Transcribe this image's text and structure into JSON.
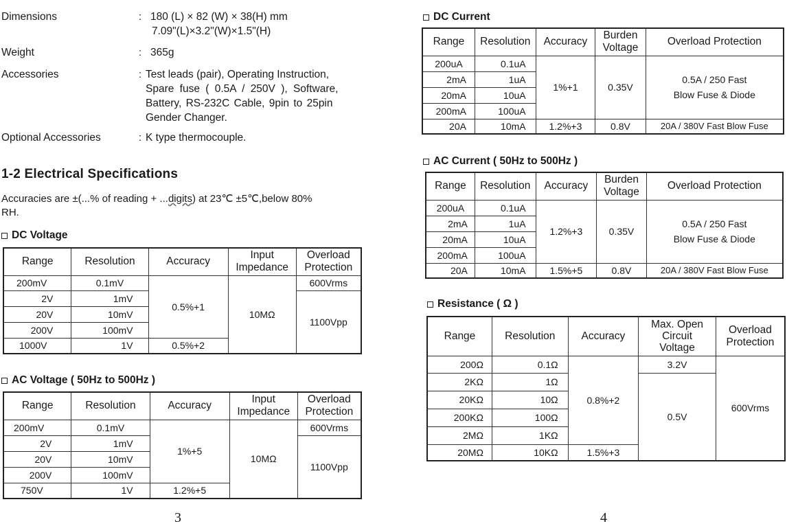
{
  "left_page": {
    "general_specs": [
      {
        "label": "Dimensions",
        "value_lines": [
          "180 (L) × 82 (W) × 38(H) mm",
          "7.09\"(L)×3.2\"(W)×1.5\"(H)"
        ]
      },
      {
        "label": "Weight",
        "value_lines": [
          "365g"
        ]
      },
      {
        "label": "Accessories",
        "value_lines": [
          "Test leads (pair), Operating Instruction,",
          "Spare fuse ( 0.5A / 250V ), Software,",
          "Battery, RS-232C Cable, 9pin to 25pin",
          "Gender Changer."
        ]
      },
      {
        "label": "Optional Accessories",
        "value_lines": [
          "K type thermocouple."
        ]
      }
    ],
    "colon": ":",
    "section_title": "1-2  Electrical Specifications",
    "accuracy_note": {
      "before": "Accuracies are ±(...% of reading + ...",
      "underlined": "digits",
      "after": ") at 23℃ ±5℃,below 80%",
      "line2": "RH."
    },
    "dc_voltage": {
      "title": "DC Voltage",
      "headers": [
        "Range",
        "Resolution",
        "Accuracy",
        "Input Impedance",
        "Overload Protection"
      ],
      "header_lines": [
        [
          "Range"
        ],
        [
          "Resolution"
        ],
        [
          "Accuracy"
        ],
        [
          "Input",
          "Impedance"
        ],
        [
          "Overload",
          "Protection"
        ]
      ],
      "ranges": [
        "200mV",
        "2V",
        "20V",
        "200V",
        "1000V"
      ],
      "resolutions": [
        "0.1mV",
        "1mV",
        "10mV",
        "100mV",
        "1V"
      ],
      "accuracy": [
        "0.5%+1",
        "0.5%+2"
      ],
      "input_impedance": "10MΩ",
      "overload": [
        "600Vrms",
        "1100Vpp"
      ]
    },
    "ac_voltage": {
      "title": "AC Voltage ( 50Hz to 500Hz )",
      "header_lines": [
        [
          "Range"
        ],
        [
          "Resolution"
        ],
        [
          "Accuracy"
        ],
        [
          "Input",
          "Impedance"
        ],
        [
          "Overload",
          "Protection"
        ]
      ],
      "ranges": [
        "200mV",
        "2V",
        "20V",
        "200V",
        "750V"
      ],
      "resolutions": [
        "0.1mV",
        "1mV",
        "10mV",
        "100mV",
        "1V"
      ],
      "accuracy": [
        "1%+5",
        "1.2%+5"
      ],
      "input_impedance": "10MΩ",
      "overload": [
        "600Vrms",
        "1100Vpp"
      ]
    },
    "page_number": "3"
  },
  "right_page": {
    "dc_current": {
      "title": "DC Current",
      "header_lines": [
        [
          "Range"
        ],
        [
          "Resolution"
        ],
        [
          "Accuracy"
        ],
        [
          "Burden",
          "Voltage"
        ],
        [
          "Overload Protection"
        ]
      ],
      "ranges": [
        "200uA",
        "2mA",
        "20mA",
        "200mA",
        "20A"
      ],
      "resolutions": [
        "0.1uA",
        "1uA",
        "10uA",
        "100uA",
        "10mA"
      ],
      "accuracy": [
        "1%+1",
        "1.2%+3"
      ],
      "burden_voltage": [
        "0.35V",
        "0.8V"
      ],
      "overload": [
        [
          "0.5A / 250 Fast",
          "Blow Fuse & Diode"
        ],
        "20A / 380V Fast Blow Fuse"
      ]
    },
    "ac_current": {
      "title": "AC Current ( 50Hz to 500Hz )",
      "header_lines": [
        [
          "Range"
        ],
        [
          "Resolution"
        ],
        [
          "Accuracy"
        ],
        [
          "Burden",
          "Voltage"
        ],
        [
          "Overload Protection"
        ]
      ],
      "ranges": [
        "200uA",
        "2mA",
        "20mA",
        "200mA",
        "20A"
      ],
      "resolutions": [
        "0.1uA",
        "1uA",
        "10uA",
        "100uA",
        "10mA"
      ],
      "accuracy": [
        "1.2%+3",
        "1.5%+5"
      ],
      "burden_voltage": [
        "0.35V",
        "0.8V"
      ],
      "overload": [
        [
          "0.5A / 250 Fast",
          "Blow Fuse & Diode"
        ],
        "20A / 380V Fast Blow Fuse"
      ]
    },
    "resistance": {
      "title": "Resistance ( Ω )",
      "header_lines": [
        [
          "Range"
        ],
        [
          "Resolution"
        ],
        [
          "Accuracy"
        ],
        [
          "Max. Open",
          "Circuit",
          "Voltage"
        ],
        [
          "Overload",
          "Protection"
        ]
      ],
      "ranges": [
        "200Ω",
        "2KΩ",
        "20KΩ",
        "200KΩ",
        "2MΩ",
        "20MΩ"
      ],
      "resolutions": [
        "0.1Ω",
        "1Ω",
        "10Ω",
        "100Ω",
        "1KΩ",
        "10KΩ"
      ],
      "accuracy": [
        "0.8%+2",
        "1.5%+3"
      ],
      "open_circuit_voltage": [
        "3.2V",
        "0.5V"
      ],
      "overload": "600Vrms"
    },
    "page_number": "4"
  }
}
